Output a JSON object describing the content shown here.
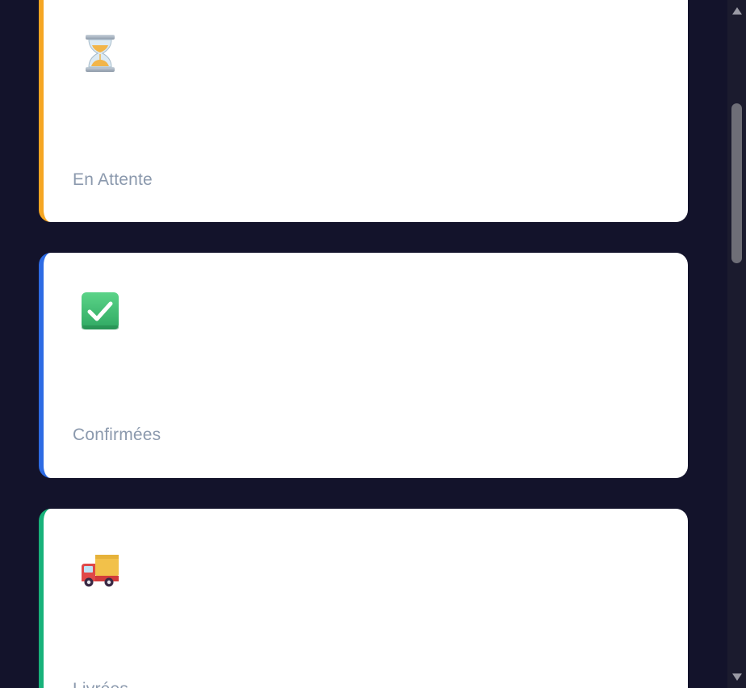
{
  "cards": [
    {
      "label": "En Attente",
      "icon": "hourglass-icon",
      "accent": "#f5a623"
    },
    {
      "label": "Confirmées",
      "icon": "check-box-icon",
      "accent": "#2d6be4"
    },
    {
      "label": "Livrées",
      "icon": "delivery-truck-icon",
      "accent": "#18b27a"
    }
  ]
}
